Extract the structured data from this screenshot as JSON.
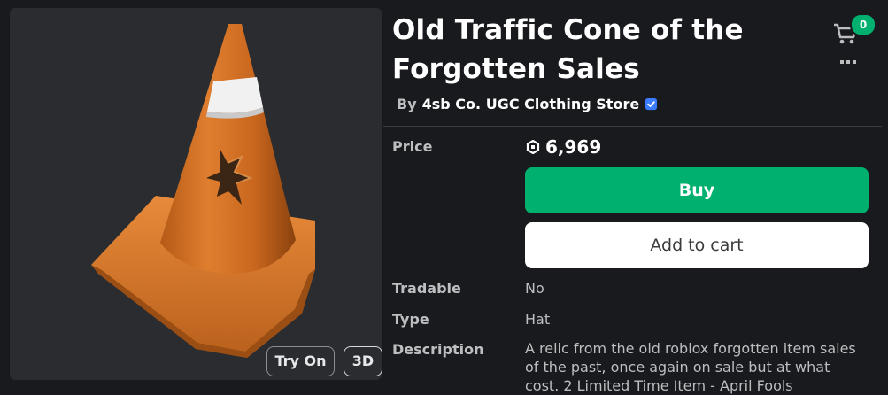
{
  "viewer": {
    "try_on_label": "Try On",
    "three_d_label": "3D"
  },
  "item": {
    "title": "Old Traffic Cone of the Forgotten Sales",
    "by_prefix": "By",
    "creator": "4sb Co. UGC Clothing Store",
    "price_label": "Price",
    "price": "6,969",
    "buy_label": "Buy",
    "add_to_cart_label": "Add to cart",
    "tradable_label": "Tradable",
    "tradable_value": "No",
    "type_label": "Type",
    "type_value": "Hat",
    "description_label": "Description",
    "description": "A relic from the old roblox forgotten item sales of the past, once again on sale but at what cost. 2 Limited Time Item - April Fools"
  },
  "header": {
    "cart_count": "0"
  },
  "colors": {
    "buy_green": "#00b06f",
    "background": "#181a1d",
    "verified_blue": "#3a7bff"
  }
}
